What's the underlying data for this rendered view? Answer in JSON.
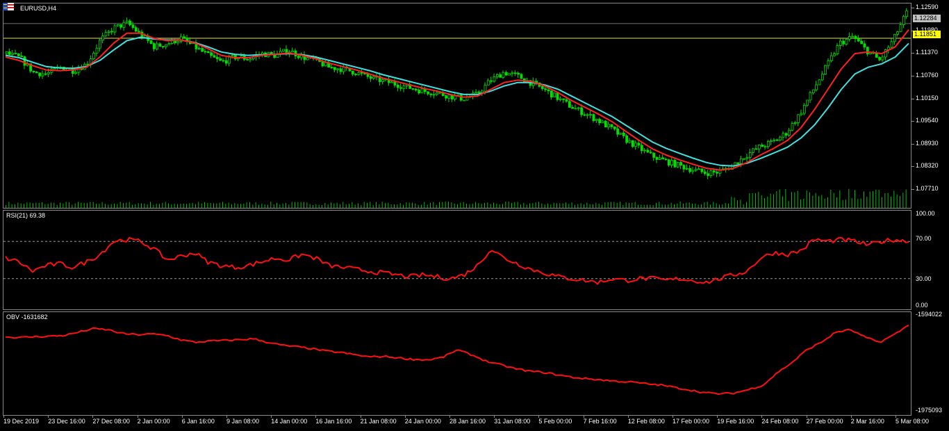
{
  "main": {
    "symbol_label": "EURUSD,H4",
    "price_axis": [
      "1.12590",
      "1.11980",
      "1.11370",
      "1.10760",
      "1.10150",
      "1.09540",
      "1.08930",
      "1.08320",
      "1.07710"
    ],
    "bid_tag": "1.12284",
    "bid_tag_bg": "#c0c0c0",
    "level_tag": "1.11851",
    "level_tag_bg": "#ffff00",
    "candle_color": "#00e000",
    "fast_ma_color": "#ff2020",
    "slow_ma_color": "#40e0e0",
    "volume_color": "#00c000",
    "level_line_color": "#e0e060",
    "bid_line_color": "#707070"
  },
  "rsi": {
    "label": "RSI(21) 69.38",
    "axis": [
      "100.00",
      "70.00",
      "30.00",
      "0.00"
    ],
    "line_color": "#ff1010"
  },
  "obv": {
    "label": "OBV -1631682",
    "axis": [
      "-1594022",
      "-1975093"
    ],
    "line_color": "#ff1010"
  },
  "time_axis": [
    "19 Dec 2019",
    "23 Dec 16:00",
    "27 Dec 08:00",
    "2 Jan 00:00",
    "6 Jan 16:00",
    "9 Jan 08:00",
    "14 Jan 00:00",
    "16 Jan 16:00",
    "21 Jan 08:00",
    "24 Jan 00:00",
    "28 Jan 16:00",
    "31 Jan 08:00",
    "5 Feb 00:00",
    "7 Feb 16:00",
    "12 Feb 08:00",
    "17 Feb 00:00",
    "19 Feb 16:00",
    "24 Feb 08:00",
    "27 Feb 00:00",
    "2 Mar 16:00",
    "5 Mar 08:00"
  ],
  "chart_data": [
    {
      "type": "candlestick",
      "title": "EURUSD,H4",
      "ylim": [
        1.074,
        1.1275
      ],
      "close_path": [
        1.114,
        1.1128,
        1.1085,
        1.108,
        1.11,
        1.109,
        1.111,
        1.118,
        1.1215,
        1.123,
        1.1195,
        1.116,
        1.117,
        1.1185,
        1.116,
        1.1135,
        1.1115,
        1.113,
        1.1125,
        1.114,
        1.1135,
        1.115,
        1.113,
        1.112,
        1.11,
        1.1095,
        1.1085,
        1.107,
        1.106,
        1.105,
        1.104,
        1.103,
        1.1025,
        1.1015,
        1.1008,
        1.102,
        1.106,
        1.1085,
        1.1075,
        1.1055,
        1.1035,
        1.101,
        1.0985,
        1.0965,
        1.0945,
        1.092,
        1.089,
        1.0865,
        1.084,
        1.0825,
        1.0812,
        1.08,
        1.079,
        1.0792,
        1.081,
        1.084,
        1.0865,
        1.088,
        1.0905,
        1.096,
        1.103,
        1.11,
        1.117,
        1.119,
        1.115,
        1.112,
        1.118,
        1.126
      ],
      "fast_ma": [
        1.113,
        1.112,
        1.1105,
        1.1092,
        1.109,
        1.1092,
        1.11,
        1.113,
        1.117,
        1.12,
        1.12,
        1.1185,
        1.1178,
        1.118,
        1.1172,
        1.1155,
        1.1135,
        1.1128,
        1.1128,
        1.1135,
        1.1138,
        1.1142,
        1.1135,
        1.1125,
        1.1112,
        1.1102,
        1.1092,
        1.108,
        1.1068,
        1.1058,
        1.1048,
        1.1038,
        1.103,
        1.102,
        1.1012,
        1.1015,
        1.1035,
        1.1055,
        1.1062,
        1.1058,
        1.1045,
        1.1025,
        1.1002,
        1.0982,
        1.0962,
        1.094,
        1.0912,
        1.0885,
        1.086,
        1.0842,
        1.0828,
        1.0815,
        1.0803,
        1.0798,
        1.0803,
        1.082,
        1.0842,
        1.0862,
        1.0885,
        1.0922,
        1.0975,
        1.1035,
        1.1095,
        1.114,
        1.1145,
        1.114,
        1.116,
        1.121
      ],
      "slow_ma": [
        1.1135,
        1.1128,
        1.1115,
        1.1102,
        1.1098,
        1.1097,
        1.1102,
        1.112,
        1.115,
        1.1178,
        1.1188,
        1.1183,
        1.118,
        1.118,
        1.1173,
        1.116,
        1.1145,
        1.1138,
        1.1135,
        1.1137,
        1.1138,
        1.114,
        1.1137,
        1.113,
        1.112,
        1.111,
        1.11,
        1.109,
        1.1078,
        1.1068,
        1.1058,
        1.1048,
        1.1038,
        1.1028,
        1.102,
        1.102,
        1.103,
        1.1045,
        1.1055,
        1.1055,
        1.1048,
        1.1035,
        1.1015,
        1.0995,
        1.0975,
        1.0955,
        1.093,
        1.0905,
        1.088,
        1.0862,
        1.0847,
        1.0833,
        1.082,
        1.0812,
        1.081,
        1.0818,
        1.0832,
        1.0848,
        1.0865,
        1.0892,
        1.093,
        1.098,
        1.1035,
        1.108,
        1.11,
        1.111,
        1.113,
        1.117
      ]
    },
    {
      "type": "line",
      "title": "RSI(21) 69.38",
      "ylim": [
        0,
        100
      ],
      "levels": [
        70,
        30
      ],
      "values": [
        52,
        48,
        38,
        44,
        46,
        42,
        48,
        56,
        70,
        72,
        70,
        62,
        50,
        54,
        58,
        48,
        44,
        42,
        44,
        48,
        52,
        50,
        56,
        52,
        44,
        42,
        40,
        38,
        36,
        34,
        32,
        34,
        32,
        30,
        34,
        44,
        62,
        52,
        46,
        40,
        36,
        32,
        30,
        28,
        26,
        30,
        28,
        30,
        30,
        28,
        30,
        28,
        26,
        30,
        34,
        38,
        52,
        58,
        56,
        60,
        72,
        70,
        72,
        70,
        66,
        70,
        72,
        69.38
      ]
    },
    {
      "type": "line",
      "title": "OBV -1631682",
      "ylim": [
        -1975093,
        -1594022
      ],
      "values": [
        -1679000,
        -1681000,
        -1678000,
        -1676000,
        -1673000,
        -1660000,
        -1646000,
        -1650000,
        -1665000,
        -1670000,
        -1667000,
        -1672000,
        -1690000,
        -1700000,
        -1695000,
        -1693000,
        -1690000,
        -1686000,
        -1700000,
        -1712000,
        -1718000,
        -1725000,
        -1735000,
        -1740000,
        -1750000,
        -1758000,
        -1756000,
        -1762000,
        -1768000,
        -1770000,
        -1760000,
        -1730000,
        -1750000,
        -1775000,
        -1790000,
        -1805000,
        -1815000,
        -1820000,
        -1830000,
        -1840000,
        -1845000,
        -1850000,
        -1855000,
        -1858000,
        -1865000,
        -1870000,
        -1880000,
        -1890000,
        -1900000,
        -1905000,
        -1902000,
        -1888000,
        -1870000,
        -1820000,
        -1780000,
        -1730000,
        -1700000,
        -1660000,
        -1650000,
        -1680000,
        -1700000,
        -1670000,
        -1631682
      ]
    }
  ]
}
